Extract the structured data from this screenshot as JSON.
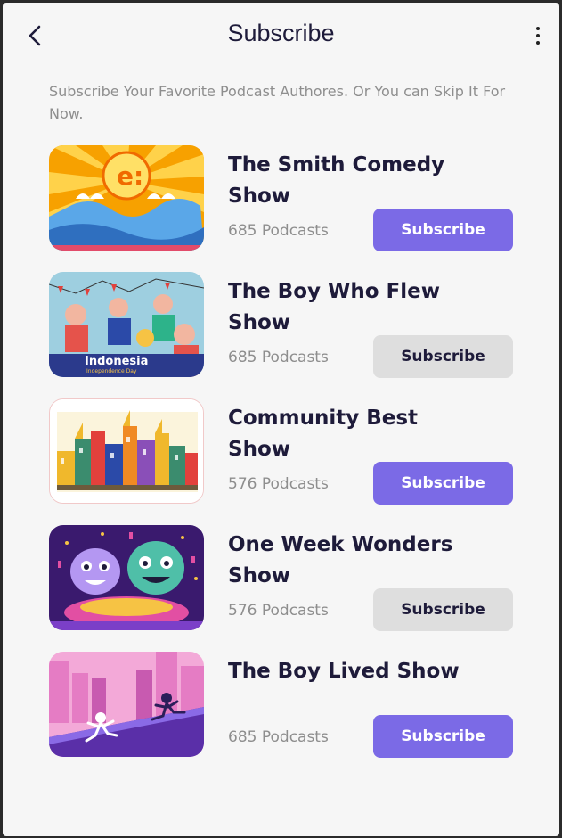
{
  "header": {
    "title": "Subscribe",
    "back_icon": "chevron-left-icon",
    "menu_icon": "more-vertical-icon"
  },
  "subtitle": "Subscribe Your Favorite Podcast Authores. Or You can Skip It For Now.",
  "colors": {
    "accent": "#7b6ae6",
    "secondary_button": "#dedede",
    "title_text": "#1e1b3a",
    "muted_text": "#8e8e8e"
  },
  "podcasts": [
    {
      "title": "The Smith Comedy Show",
      "count": "685 Podcasts",
      "button": "Subscribe",
      "subscribed_style": "primary"
    },
    {
      "title": "The Boy Who Flew Show",
      "count": "685 Podcasts",
      "button": "Subscribe",
      "subscribed_style": "secondary"
    },
    {
      "title": "Community Best Show",
      "count": "576 Podcasts",
      "button": "Subscribe",
      "subscribed_style": "primary"
    },
    {
      "title": "One Week Wonders Show",
      "count": "576 Podcasts",
      "button": "Subscribe",
      "subscribed_style": "secondary"
    },
    {
      "title": "The Boy Lived Show",
      "count": "685 Podcasts",
      "button": "Subscribe",
      "subscribed_style": "primary"
    }
  ]
}
